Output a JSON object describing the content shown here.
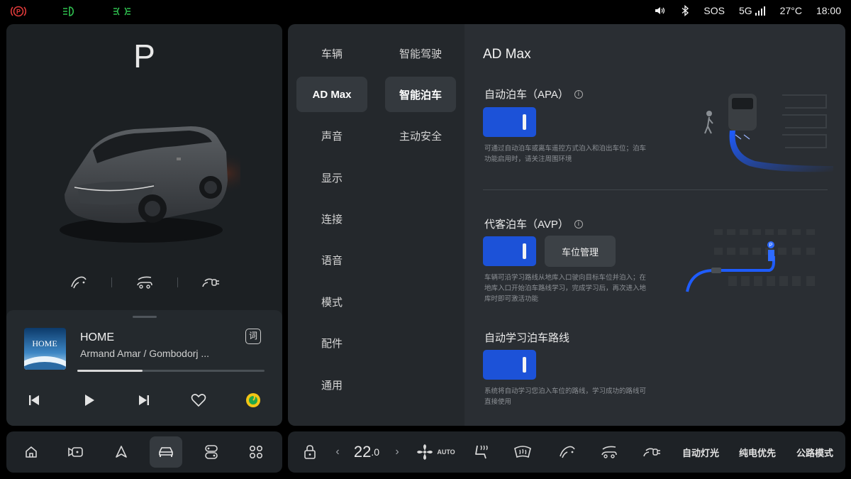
{
  "status_bar": {
    "left_icons": [
      "parking-brake-icon",
      "headlight-icon",
      "side-light-icon"
    ],
    "sos": "SOS",
    "network": "5G",
    "temperature": "27°C",
    "time": "18:00"
  },
  "car": {
    "gear": "P",
    "actions": [
      "tailgate-icon",
      "frunk-icon",
      "charge-port-icon"
    ]
  },
  "media": {
    "album_text": "HOME",
    "title": "HOME",
    "artist": "Armand Amar / Gombodorj ...",
    "lyrics_label": "词",
    "progress": 0.35
  },
  "settings": {
    "nav_primary": [
      "车辆",
      "AD Max",
      "声音",
      "显示",
      "连接",
      "语音",
      "模式",
      "配件",
      "通用"
    ],
    "nav_primary_active": 1,
    "nav_secondary": [
      "智能驾驶",
      "智能泊车",
      "主动安全"
    ],
    "nav_secondary_active": 1,
    "page_title": "AD Max",
    "apa": {
      "title": "自动泊车（APA）",
      "enabled": true,
      "desc_line1": "可通过自动泊车或离车遥控方式泊入和泊出车位；泊车",
      "desc_line2": "功能启用时，请关注周围环境"
    },
    "avp": {
      "title": "代客泊车（AVP）",
      "enabled": true,
      "manage_label": "车位管理",
      "desc_line1": "车辆可沿学习路线从地库入口驶向目标车位并泊入；在",
      "desc_line2": "地库入口开始泊车路线学习，完成学习后，再次进入地",
      "desc_line3": "库时即可激活功能",
      "p_marker": "P"
    },
    "learn": {
      "title": "自动学习泊车路线",
      "enabled": true,
      "desc_line1": "系统将自动学习您泊入车位的路线，学习成功的路线可",
      "desc_line2": "直接使用"
    }
  },
  "dock_left": {
    "items": [
      "home-icon",
      "camera-icon",
      "navigation-icon",
      "car-icon",
      "switch-icon",
      "apps-icon"
    ],
    "active": 3
  },
  "dock_right": {
    "temperature": "22.0",
    "temp_int": "22",
    "temp_dec": ".0",
    "fan_auto": "AUTO",
    "auto_light": "自动灯光",
    "ev_priority": "纯电优先",
    "road_mode": "公路模式"
  },
  "colors": {
    "accent_blue": "#1c52d8",
    "background": "#000000",
    "panel": "#24282c"
  }
}
